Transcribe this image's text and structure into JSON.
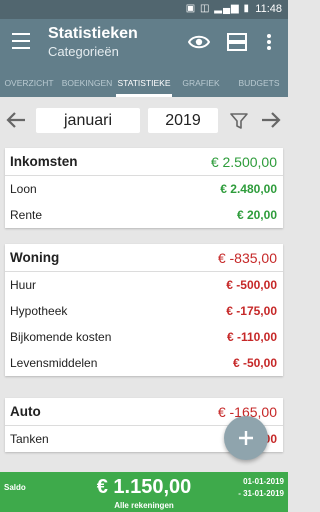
{
  "status_bar": {
    "time": "11:48",
    "icons": [
      "screen-icon",
      "sim-icon",
      "signal-icon",
      "battery-icon"
    ]
  },
  "app_bar": {
    "title": "Statistieken",
    "subtitle": "Categorieën"
  },
  "tabs": [
    {
      "label": "OVERZICHT",
      "active": false
    },
    {
      "label": "BOEKINGEN",
      "active": false
    },
    {
      "label": "STATISTIEKE",
      "active": true
    },
    {
      "label": "GRAFIEK",
      "active": false
    },
    {
      "label": "BUDGETS",
      "active": false
    }
  ],
  "period": {
    "month": "januari",
    "year": "2019"
  },
  "groups": [
    {
      "title": "Inkomsten",
      "total": "€ 2.500,00",
      "tone": "green",
      "items": [
        {
          "label": "Loon",
          "amount": "€ 2.480,00"
        },
        {
          "label": "Rente",
          "amount": "€ 20,00"
        }
      ]
    },
    {
      "title": "Woning",
      "total": "€ -835,00",
      "tone": "red",
      "items": [
        {
          "label": "Huur",
          "amount": "€ -500,00"
        },
        {
          "label": "Hypotheek",
          "amount": "€ -175,00"
        },
        {
          "label": "Bijkomende kosten",
          "amount": "€ -110,00"
        },
        {
          "label": "Levensmiddelen",
          "amount": "€ -50,00"
        }
      ]
    },
    {
      "title": "Auto",
      "total": "€ -165,00",
      "tone": "red",
      "items": [
        {
          "label": "Tanken",
          "amount": "€ -165,00"
        }
      ]
    }
  ],
  "footer": {
    "saldo_label": "Saldo",
    "amount": "€ 1.150,00",
    "sub": "Alle rekeningen",
    "date_from": "01-01-2019",
    "date_to": "- 31-01-2019"
  },
  "colors": {
    "appbar": "#627e8a",
    "statusbar": "#51666f",
    "income": "#2e9c3b",
    "expense": "#c62828",
    "footer": "#3eaa4b"
  }
}
